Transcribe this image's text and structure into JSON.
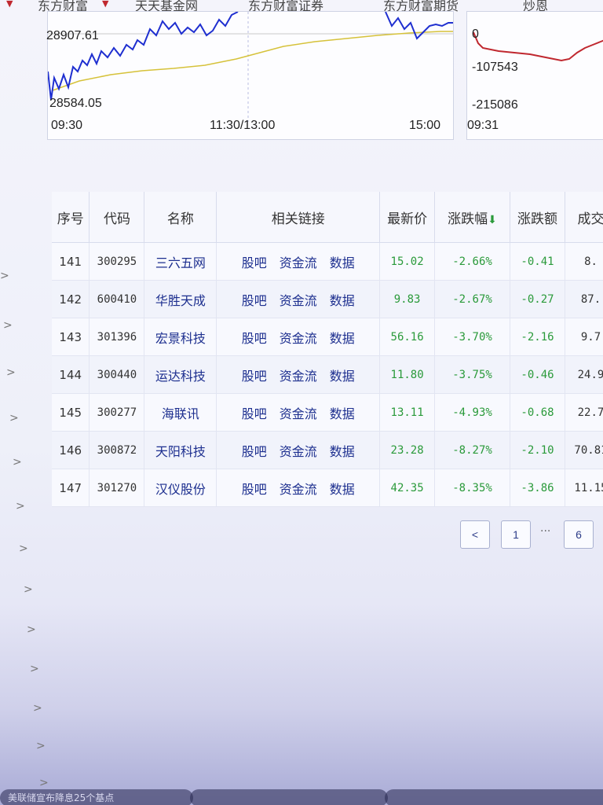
{
  "top_tabs": [
    "东方财富",
    "天天基金网",
    "东方财富证券",
    "东方财富期货",
    "炒恩"
  ],
  "chart_main": {
    "high_label": "28907.61",
    "low_label": "28584.05",
    "time_labels": [
      "09:30",
      "11:30/13:00",
      "15:00"
    ]
  },
  "chart_flow": {
    "y_labels": [
      "0",
      "-107543",
      "-215086"
    ],
    "time_label": "09:31"
  },
  "table": {
    "headers": [
      "序号",
      "代码",
      "名称",
      "相关链接",
      "最新价",
      "涨跌幅",
      "涨跌额",
      "成交"
    ],
    "link_labels": [
      "股吧",
      "资金流",
      "数据"
    ],
    "rows": [
      {
        "idx": "141",
        "code": "300295",
        "name": "三六五网",
        "price": "15.02",
        "pct": "-2.66%",
        "chg": "-0.41",
        "vol": "8."
      },
      {
        "idx": "142",
        "code": "600410",
        "name": "华胜天成",
        "price": "9.83",
        "pct": "-2.67%",
        "chg": "-0.27",
        "vol": "87."
      },
      {
        "idx": "143",
        "code": "301396",
        "name": "宏景科技",
        "price": "56.16",
        "pct": "-3.70%",
        "chg": "-2.16",
        "vol": "9.7"
      },
      {
        "idx": "144",
        "code": "300440",
        "name": "运达科技",
        "price": "11.80",
        "pct": "-3.75%",
        "chg": "-0.46",
        "vol": "24.9"
      },
      {
        "idx": "145",
        "code": "300277",
        "name": "海联讯",
        "price": "13.11",
        "pct": "-4.93%",
        "chg": "-0.68",
        "vol": "22.7"
      },
      {
        "idx": "146",
        "code": "300872",
        "name": "天阳科技",
        "price": "23.28",
        "pct": "-8.27%",
        "chg": "-2.10",
        "vol": "70.81"
      },
      {
        "idx": "147",
        "code": "301270",
        "name": "汉仪股份",
        "price": "42.35",
        "pct": "-8.35%",
        "chg": "-3.86",
        "vol": "11.15"
      }
    ]
  },
  "pagination": {
    "prev": "<",
    "first": "1",
    "ellipsis": "···",
    "last": "6"
  },
  "bottom_news": [
    "美联储宣布降息25个基点",
    "",
    ""
  ],
  "colors": {
    "down_green": "#2a9a3a",
    "link_blue": "#1d2f8f",
    "price_line": "#1f2fd0",
    "avg_line": "#d6c23a",
    "flow_line": "#c0282f"
  }
}
